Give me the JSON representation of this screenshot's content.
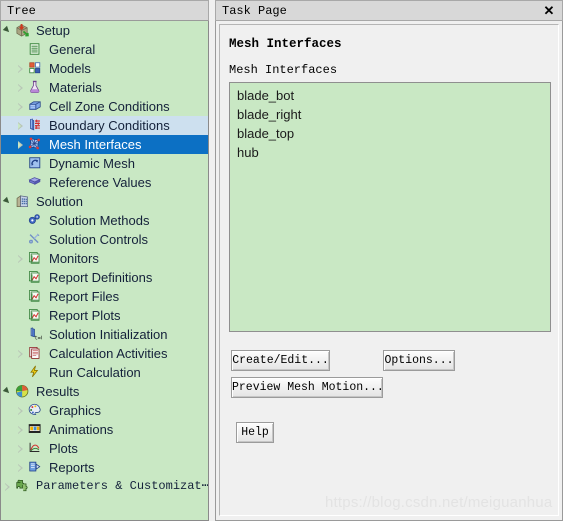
{
  "tree_panel": {
    "title": "Tree",
    "items": [
      {
        "label": "Setup",
        "icon": "setup-box-icon",
        "indent": 0,
        "twisty": "expanded",
        "state": "normal",
        "font": "sans"
      },
      {
        "label": "General",
        "icon": "general-list-icon",
        "indent": 1,
        "twisty": "none",
        "state": "normal",
        "font": "sans"
      },
      {
        "label": "Models",
        "icon": "models-squares-icon",
        "indent": 1,
        "twisty": "collapsed",
        "state": "normal",
        "font": "sans"
      },
      {
        "label": "Materials",
        "icon": "materials-flask-icon",
        "indent": 1,
        "twisty": "collapsed",
        "state": "normal",
        "font": "sans"
      },
      {
        "label": "Cell Zone Conditions",
        "icon": "cell-zone-cube-icon",
        "indent": 1,
        "twisty": "collapsed",
        "state": "normal",
        "font": "sans"
      },
      {
        "label": "Boundary Conditions",
        "icon": "boundary-conditions-icon",
        "indent": 1,
        "twisty": "collapsed",
        "state": "hover",
        "font": "sans"
      },
      {
        "label": "Mesh Interfaces",
        "icon": "mesh-interfaces-icon",
        "indent": 1,
        "twisty": "collapsed",
        "state": "selected",
        "font": "sans"
      },
      {
        "label": "Dynamic Mesh",
        "icon": "dynamic-mesh-icon",
        "indent": 1,
        "twisty": "none",
        "state": "normal",
        "font": "sans"
      },
      {
        "label": "Reference Values",
        "icon": "reference-values-book-icon",
        "indent": 1,
        "twisty": "none",
        "state": "normal",
        "font": "sans"
      },
      {
        "label": "Solution",
        "icon": "solution-building-icon",
        "indent": 0,
        "twisty": "expanded",
        "state": "normal",
        "font": "sans"
      },
      {
        "label": "Solution Methods",
        "icon": "solution-methods-icon",
        "indent": 1,
        "twisty": "none",
        "state": "normal",
        "font": "sans"
      },
      {
        "label": "Solution Controls",
        "icon": "solution-controls-tools-icon",
        "indent": 1,
        "twisty": "none",
        "state": "normal",
        "font": "sans"
      },
      {
        "label": "Monitors",
        "icon": "monitors-report-icon",
        "indent": 1,
        "twisty": "collapsed",
        "state": "normal",
        "font": "sans"
      },
      {
        "label": "Report Definitions",
        "icon": "monitors-report-icon",
        "indent": 1,
        "twisty": "none",
        "state": "normal",
        "font": "sans"
      },
      {
        "label": "Report Files",
        "icon": "monitors-report-icon",
        "indent": 1,
        "twisty": "none",
        "state": "normal",
        "font": "sans"
      },
      {
        "label": "Report Plots",
        "icon": "monitors-report-icon",
        "indent": 1,
        "twisty": "none",
        "state": "normal",
        "font": "sans"
      },
      {
        "label": "Solution Initialization",
        "icon": "solution-initialization-icon",
        "indent": 1,
        "twisty": "none",
        "state": "normal",
        "font": "sans"
      },
      {
        "label": "Calculation Activities",
        "icon": "calculation-activities-icon",
        "indent": 1,
        "twisty": "collapsed",
        "state": "normal",
        "font": "sans"
      },
      {
        "label": "Run Calculation",
        "icon": "run-calculation-lightning-icon",
        "indent": 1,
        "twisty": "none",
        "state": "normal",
        "font": "sans"
      },
      {
        "label": "Results",
        "icon": "results-sphere-icon",
        "indent": 0,
        "twisty": "expanded",
        "state": "normal",
        "font": "sans"
      },
      {
        "label": "Graphics",
        "icon": "graphics-palette-icon",
        "indent": 1,
        "twisty": "collapsed",
        "state": "normal",
        "font": "sans"
      },
      {
        "label": "Animations",
        "icon": "animations-film-icon",
        "indent": 1,
        "twisty": "collapsed",
        "state": "normal",
        "font": "sans"
      },
      {
        "label": "Plots",
        "icon": "plots-curve-icon",
        "indent": 1,
        "twisty": "collapsed",
        "state": "normal",
        "font": "sans"
      },
      {
        "label": "Reports",
        "icon": "reports-icon",
        "indent": 1,
        "twisty": "collapsed",
        "state": "normal",
        "font": "sans"
      },
      {
        "label": "Parameters & Customizat⋯",
        "icon": "parameters-puzzle-icon",
        "indent": 0,
        "twisty": "collapsed",
        "state": "normal",
        "font": "mono"
      }
    ]
  },
  "task_page": {
    "title": "Task Page",
    "close_label": "✕",
    "heading": "Mesh Interfaces",
    "list_caption": "Mesh Interfaces",
    "list_items": [
      "blade_bot",
      "blade_right",
      "blade_top",
      "hub"
    ],
    "buttons": {
      "create_edit": "Create/Edit...",
      "options": "Options...",
      "preview_mesh_motion": "Preview Mesh Motion...",
      "help": "Help"
    }
  },
  "watermark": "https://blog.csdn.net/meiguanhua",
  "colors": {
    "tree_background": "#c9e8c4",
    "selection_blue": "#0c70c4",
    "hover_blue": "#cde0ef",
    "titlebar_gray": "#d8d8d8",
    "panel_gray": "#f0f0f0"
  }
}
